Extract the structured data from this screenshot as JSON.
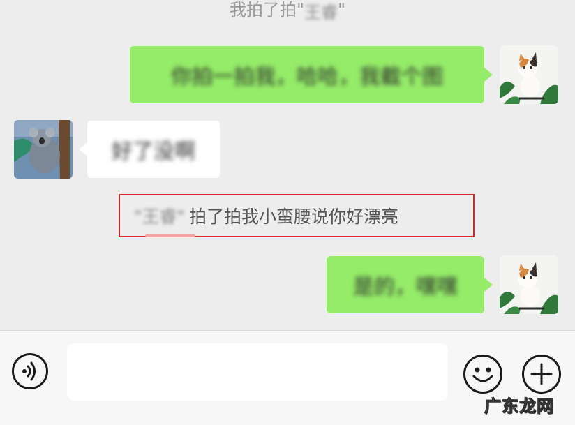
{
  "system_top": {
    "prefix": "我拍了拍\"",
    "name": "王睿",
    "suffix": "\""
  },
  "messages": [
    {
      "side": "right",
      "text": "你拍一拍我，哈哈，我截个图",
      "avatar": "kitten-avatar"
    },
    {
      "side": "left",
      "text": "好了没啊",
      "avatar": "koala-avatar"
    },
    {
      "side": "right",
      "text": "是的，嘿嘿",
      "avatar": "kitten-avatar"
    }
  ],
  "pat_notice": {
    "name": "\"王睿\"",
    "text": "拍了拍我小蛮腰说你好漂亮"
  },
  "input": {
    "value": "",
    "placeholder": ""
  },
  "icons": {
    "voice": "voice-icon",
    "emoji": "emoji-icon",
    "plus": "plus-icon"
  },
  "watermark": "广东龙网",
  "colors": {
    "chat_bg": "#ededed",
    "bubble_self": "#95ec69",
    "bubble_other": "#ffffff",
    "highlight_border": "#d9262b"
  }
}
